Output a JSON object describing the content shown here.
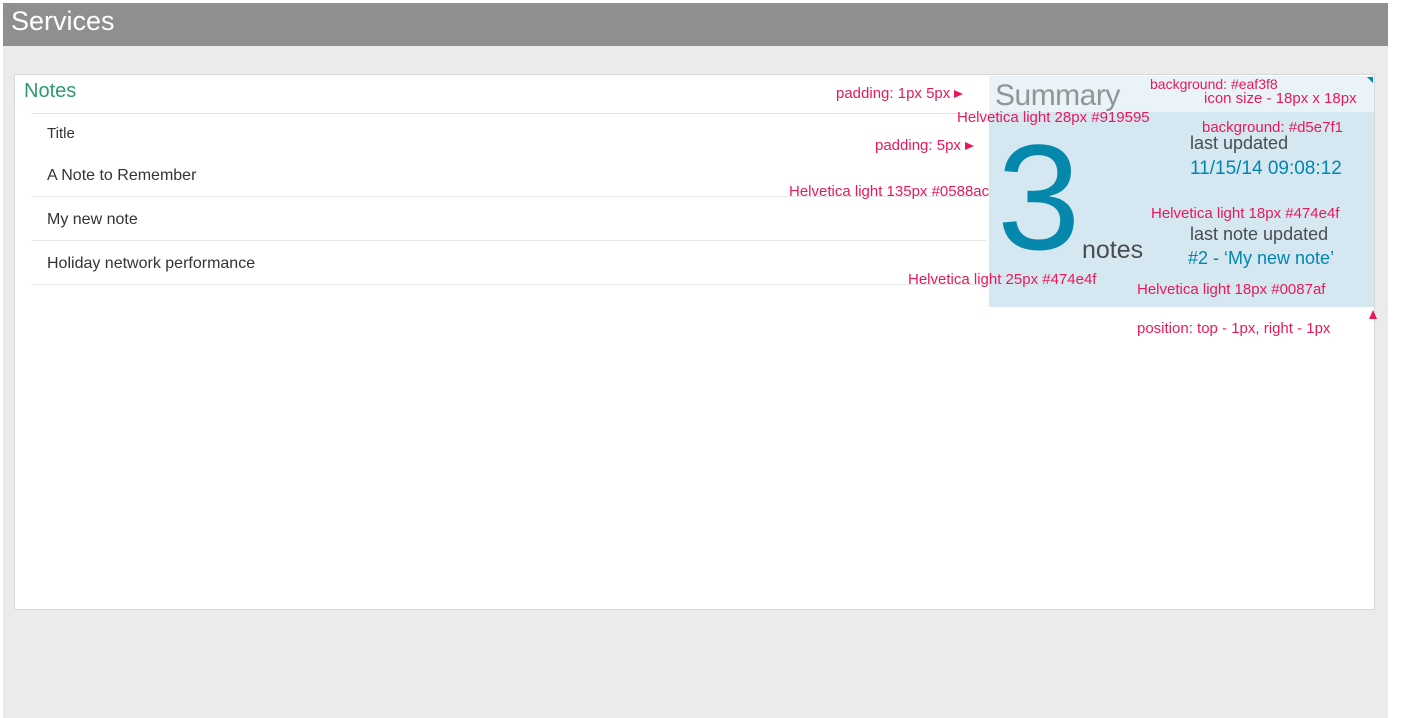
{
  "header": {
    "title": "Services"
  },
  "panel": {
    "title": "Notes",
    "table": {
      "column_header": "Title",
      "rows": [
        "A Note to Remember",
        "My new note",
        "Holiday network performance"
      ]
    }
  },
  "summary": {
    "title": "Summary",
    "count": "3",
    "count_unit": "notes",
    "last_updated_label": "last updated",
    "last_updated_value": "11/15/14 09:08:12",
    "last_note_label": "last note updated",
    "last_note_value": "#2 - ‘My new note’",
    "icon": "corner-triangle-icon"
  },
  "annotations": {
    "padding_title": "padding: 1px 5px",
    "bg_top": "background: #eaf3f8",
    "icon_size": "icon size - 18px x 18px",
    "title_font": "Helvetica light 28px #919595",
    "bg_body": "background: #d5e7f1",
    "padding_body": "padding: 5px",
    "number_font": "Helvetica light 135px #0588ac",
    "label_font": "Helvetica light 18px #474e4f",
    "unit_font": "Helvetica light 25px #474e4f",
    "value_font": "Helvetica light 18px #0087af",
    "position": "position: top - 1px, right - 1px"
  },
  "colors": {
    "header_bg": "#8e9090",
    "panel_title": "#2e9a6a",
    "summary_top_bg": "#eaf3f8",
    "summary_body_bg": "#d5e7f1",
    "number": "#0588ac",
    "label": "#474e4f",
    "value": "#0087af",
    "annotation": "#e8195a"
  }
}
